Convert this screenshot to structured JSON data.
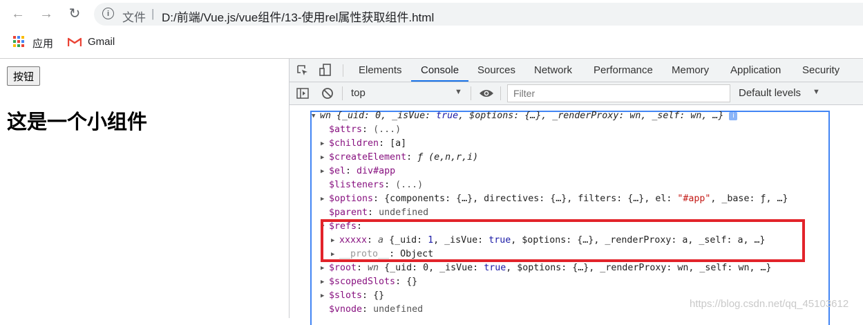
{
  "browser": {
    "back_glyph": "←",
    "forward_glyph": "→",
    "reload_glyph": "↻",
    "scheme_label": "文件",
    "separator": "|",
    "url": "D:/前端/Vue.js/vue组件/13-使用rel属性获取组件.html",
    "bookmarks": [
      {
        "label": "应用",
        "icon": "apps-icon"
      },
      {
        "label": "Gmail",
        "icon": "gmail-icon"
      }
    ]
  },
  "page": {
    "button_label": "按钮",
    "heading": "这是一个小组件"
  },
  "devtools": {
    "tabs": [
      "Elements",
      "Console",
      "Sources",
      "Network",
      "Performance",
      "Memory",
      "Application",
      "Security"
    ],
    "active_tab": "Console",
    "context": "top",
    "filter_placeholder": "Filter",
    "levels": "Default levels"
  },
  "console": {
    "root": {
      "name": "wn",
      "summary_a": "{_uid: 0, _isVue: ",
      "summary_true": "true",
      "summary_b": ", $options: {…}, _renderProxy: wn, _self: wn, …}"
    },
    "attrs": {
      "key": "$attrs",
      "value": "(...)"
    },
    "children": {
      "key": "$children",
      "value": "[a]"
    },
    "createElement": {
      "key": "$createElement",
      "value": "ƒ (e,n,r,i)"
    },
    "el": {
      "key": "$el",
      "value": "div#app"
    },
    "listeners": {
      "key": "$listeners",
      "value": "(...)"
    },
    "options": {
      "key": "$options",
      "pre": "{components: {…}, directives: {…}, filters: {…}, el: ",
      "str": "\"#app\"",
      "post": ", _base: ƒ, …}"
    },
    "parent": {
      "key": "$parent",
      "value": "undefined"
    },
    "refs": {
      "key": "$refs"
    },
    "xxxxx": {
      "key": "xxxxx",
      "name": "a",
      "summary_a": "{_uid: ",
      "uid": "1",
      "summary_b": ", _isVue: ",
      "summary_true": "true",
      "summary_c": ", $options: {…}, _renderProxy: a, _self: a, …}"
    },
    "proto": {
      "key": "__proto__",
      "value": "Object"
    },
    "root_ref": {
      "key": "$root",
      "name": "wn",
      "summary_a": "{_uid: 0, _isVue: ",
      "summary_true": "true",
      "summary_b": ", $options: {…}, _renderProxy: wn, _self: wn, …}"
    },
    "scopedSlots": {
      "key": "$scopedSlots",
      "value": "{}"
    },
    "slots": {
      "key": "$slots",
      "value": "{}"
    },
    "vnode": {
      "key": "$vnode",
      "value": "undefined"
    }
  },
  "watermark": "https://blog.csdn.net/qq_45103612",
  "colors": {
    "accent": "#1a73e8",
    "highlight": "#e2232a",
    "frame": "#4285f4"
  }
}
